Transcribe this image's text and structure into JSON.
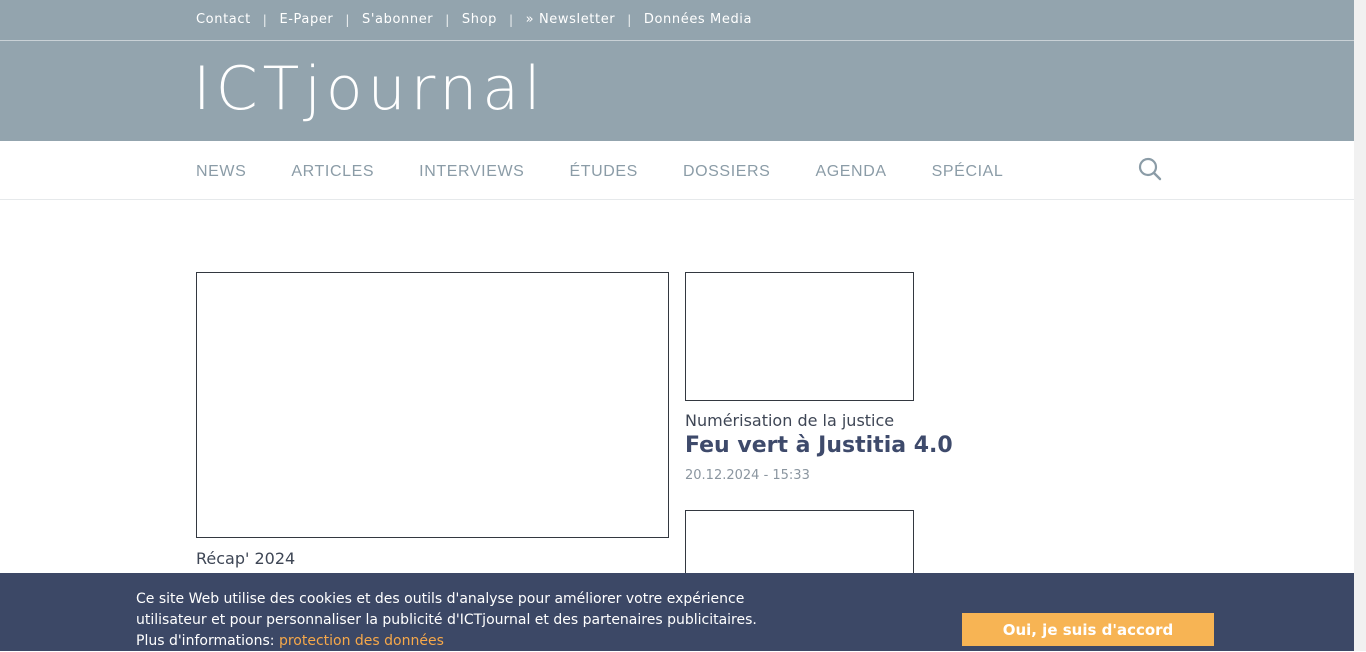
{
  "topnav": {
    "items": [
      "Contact",
      "E-Paper",
      "S'abonner",
      "Shop",
      "» Newsletter",
      "Données Media"
    ],
    "separator": "|"
  },
  "logo": {
    "text": "ICTjournal"
  },
  "mainnav": {
    "items": [
      "NEWS",
      "ARTICLES",
      "INTERVIEWS",
      "ÉTUDES",
      "DOSSIERS",
      "AGENDA",
      "SPÉCIAL"
    ]
  },
  "articles": {
    "featured": {
      "kicker": "Récap' 2024"
    },
    "side1": {
      "kicker": "Numérisation de la justice",
      "title": "Feu vert à Justitia 4.0",
      "date": "20.12.2024 - 15:33"
    }
  },
  "cookie": {
    "line1": "Ce site Web utilise des cookies et des outils d'analyse pour améliorer votre expérience",
    "line2": "utilisateur et pour personnaliser la publicité d'ICTjournal et des partenaires publicitaires.",
    "line3_prefix": "Plus d'informations: ",
    "link": "protection des données",
    "accept": "Oui, je suis d'accord"
  },
  "colors": {
    "header_bg": "#93a4ae",
    "nav_text": "#8b9ca7",
    "cookie_bg": "#3c4866",
    "accent": "#f7b454"
  }
}
